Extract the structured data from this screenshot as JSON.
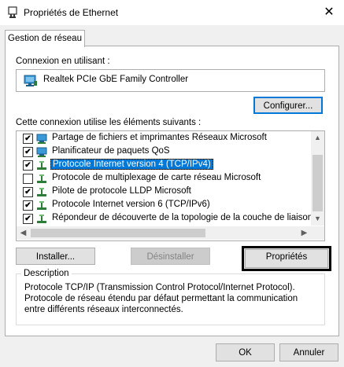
{
  "window": {
    "title": "Propriétés de Ethernet",
    "close_glyph": "✕"
  },
  "tabs": [
    {
      "label": "Gestion de réseau"
    }
  ],
  "connection": {
    "label": "Connexion en utilisant :",
    "adapter": "Realtek PCIe GbE Family Controller",
    "configure_label": "Configurer..."
  },
  "items_label": "Cette connexion utilise les éléments suivants :",
  "items": [
    {
      "label": "Partage de fichiers et imprimantes Réseaux Microsoft",
      "checked": true,
      "icon": "network-share-icon"
    },
    {
      "label": "Planificateur de paquets QoS",
      "checked": true,
      "icon": "network-share-icon"
    },
    {
      "label": "Protocole Internet version 4 (TCP/IPv4)",
      "checked": true,
      "icon": "protocol-icon",
      "selected": true
    },
    {
      "label": "Protocole de multiplexage de carte réseau Microsoft",
      "checked": false,
      "icon": "protocol-icon"
    },
    {
      "label": "Pilote de protocole LLDP Microsoft",
      "checked": true,
      "icon": "protocol-icon"
    },
    {
      "label": "Protocole Internet version 6 (TCP/IPv6)",
      "checked": true,
      "icon": "protocol-icon"
    },
    {
      "label": "Répondeur de découverte de la topologie de la couche de liaison",
      "checked": true,
      "icon": "protocol-icon"
    }
  ],
  "buttons": {
    "install": "Installer...",
    "uninstall": "Désinstaller",
    "properties": "Propriétés",
    "ok": "OK",
    "cancel": "Annuler"
  },
  "description": {
    "title": "Description",
    "text": "Protocole TCP/IP (Transmission Control Protocol/Internet Protocol). Protocole de réseau étendu par défaut permettant la communication entre différents réseaux interconnectés."
  },
  "colors": {
    "selection": "#0078d7",
    "button_face": "#e1e1e1",
    "window_bg": "#f0f0f0"
  }
}
